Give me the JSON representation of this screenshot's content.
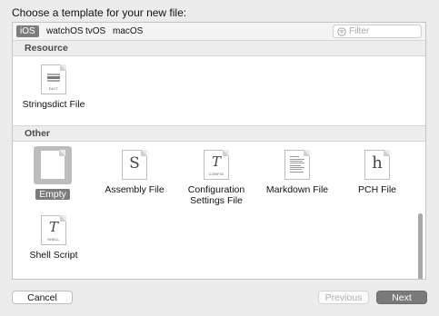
{
  "dialog": {
    "title": "Choose a template for your new file:"
  },
  "platform_tabs": [
    {
      "label": "iOS",
      "selected": true
    },
    {
      "label": "watchOS",
      "selected": false
    },
    {
      "label": "tvOS",
      "selected": false
    },
    {
      "label": "macOS",
      "selected": false
    }
  ],
  "filter": {
    "placeholder": "Filter",
    "icon": "filter-icon"
  },
  "sections": {
    "resource": {
      "header": "Resource",
      "items": [
        {
          "label": "Stringsdict File",
          "icon": "stringsdict-file-icon",
          "icon_text": "DICT"
        }
      ]
    },
    "other": {
      "header": "Other",
      "items": [
        {
          "label": "Empty",
          "icon": "empty-file-icon",
          "selected": true
        },
        {
          "label": "Assembly File",
          "icon": "assembly-file-icon",
          "glyph": "S"
        },
        {
          "label": "Configuration\nSettings File",
          "icon": "config-file-icon",
          "glyph": "T",
          "icon_text": "CONFIG"
        },
        {
          "label": "Markdown File",
          "icon": "markdown-file-icon"
        },
        {
          "label": "PCH File",
          "icon": "pch-file-icon",
          "glyph": "h"
        },
        {
          "label": "Shell Script",
          "icon": "shell-script-icon",
          "glyph": "T",
          "icon_text": "SHELL"
        }
      ]
    }
  },
  "buttons": {
    "cancel": "Cancel",
    "previous": "Previous",
    "next": "Next"
  },
  "colors": {
    "selection": "#7c7c7c",
    "next_button": "#7a7a7a"
  }
}
